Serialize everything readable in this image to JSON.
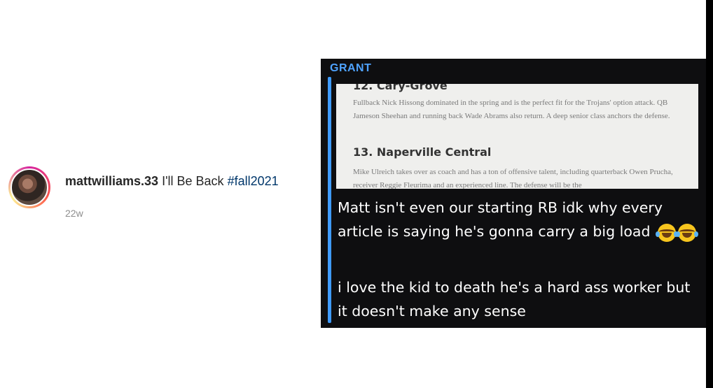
{
  "comment": {
    "username": "mattwilliams.33",
    "text": "I'll Be Back",
    "hashtag": "#fall2021",
    "timestamp": "22w"
  },
  "embedded_screenshot": {
    "sender": "GRANT",
    "article": {
      "item_12_heading": "12. Cary-Grove",
      "item_12_body": "Fullback Nick Hissong dominated in the spring and is the perfect fit for the Trojans' option attack. QB Jameson Sheehan and running back Wade Abrams also return. A deep senior class anchors the defense.",
      "item_13_heading": "13. Naperville Central",
      "item_13_body": "Mike Ulreich takes over as coach and has a ton of offensive talent, including quarterback Owen Prucha, receiver Reggie Fleurima and an experienced line. The defense will be the"
    },
    "caption_1": "Matt isn't even our starting RB idk why every article is saying he's gonna carry a big load",
    "caption_1_emoji": "laughing-crying-emoji x2",
    "caption_2": "i love the kid to death he's a hard ass worker but it doesn't make any sense"
  }
}
